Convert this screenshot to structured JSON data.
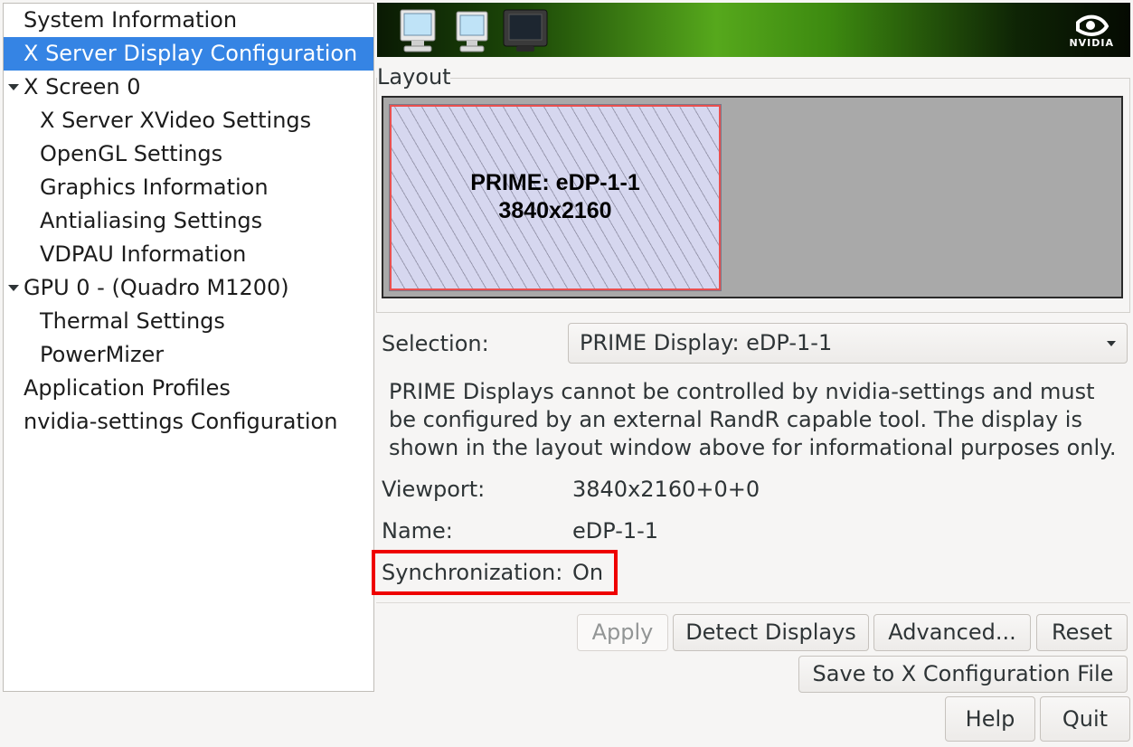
{
  "sidebar": {
    "items": [
      {
        "label": "System Information"
      },
      {
        "label": "X Server Display Configuration"
      },
      {
        "label": "X Screen 0"
      },
      {
        "label": "X Server XVideo Settings"
      },
      {
        "label": "OpenGL Settings"
      },
      {
        "label": "Graphics Information"
      },
      {
        "label": "Antialiasing Settings"
      },
      {
        "label": "VDPAU Information"
      },
      {
        "label": "GPU 0 - (Quadro M1200)"
      },
      {
        "label": "Thermal Settings"
      },
      {
        "label": "PowerMizer"
      },
      {
        "label": "Application Profiles"
      },
      {
        "label": "nvidia-settings Configuration"
      }
    ],
    "selected": "X Server Display Configuration"
  },
  "banner": {
    "brand": "NVIDIA",
    "icons": [
      "monitor-icon",
      "monitor-icon",
      "monitor-icon"
    ]
  },
  "layout": {
    "title": "Layout",
    "display_name": "PRIME: eDP-1-1",
    "display_resolution": "3840x2160"
  },
  "selection": {
    "label": "Selection:",
    "value": "PRIME Display: eDP-1-1"
  },
  "info_text": "PRIME Displays cannot be controlled by nvidia-settings and must be configured by an external RandR capable tool. The display is shown in the layout window above for informational purposes only.",
  "details": {
    "viewport_label": "Viewport:",
    "viewport_value": "3840x2160+0+0",
    "name_label": "Name:",
    "name_value": "eDP-1-1",
    "sync_label": "Synchronization:",
    "sync_value": "On"
  },
  "buttons": {
    "apply": "Apply",
    "detect": "Detect Displays",
    "advanced": "Advanced...",
    "reset": "Reset",
    "save": "Save to X Configuration File",
    "help": "Help",
    "quit": "Quit"
  },
  "colors": {
    "selection": "#3584e4",
    "highlight": "#ee0000",
    "display_border": "#e9504f"
  }
}
